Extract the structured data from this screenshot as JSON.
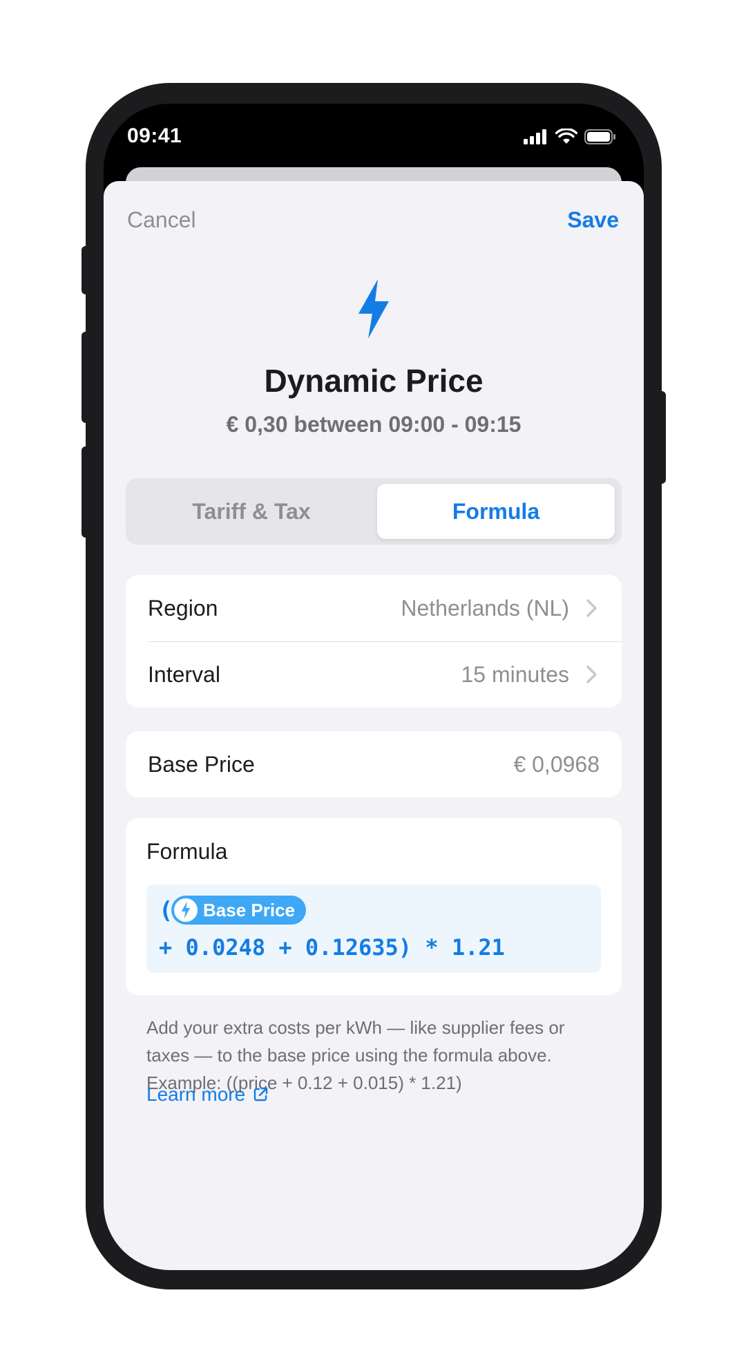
{
  "status_bar": {
    "time": "09:41"
  },
  "nav": {
    "cancel_label": "Cancel",
    "save_label": "Save"
  },
  "header": {
    "icon": "bolt-icon",
    "title": "Dynamic Price",
    "subtitle": "€ 0,30 between 09:00 - 09:15"
  },
  "segments": [
    {
      "label": "Tariff & Tax",
      "selected": false
    },
    {
      "label": "Formula",
      "selected": true
    }
  ],
  "settings": {
    "region": {
      "label": "Region",
      "value": "Netherlands (NL)"
    },
    "interval": {
      "label": "Interval",
      "value": "15 minutes"
    }
  },
  "base_price": {
    "label": "Base Price",
    "value": "€ 0,0968"
  },
  "formula": {
    "title": "Formula",
    "open_paren": "(",
    "chip_label": "Base Price",
    "expression": "+ 0.0248 + 0.12635) * 1.21"
  },
  "help": {
    "text": "Add your extra costs per kWh — like supplier fees or taxes — to the base price using the formula above. Example: ((price + 0.12 + 0.015) * 1.21)",
    "learn_more": "Learn more"
  },
  "colors": {
    "accent": "#147ce5",
    "chip": "#3ea8f5",
    "background": "#f2f2f7"
  }
}
